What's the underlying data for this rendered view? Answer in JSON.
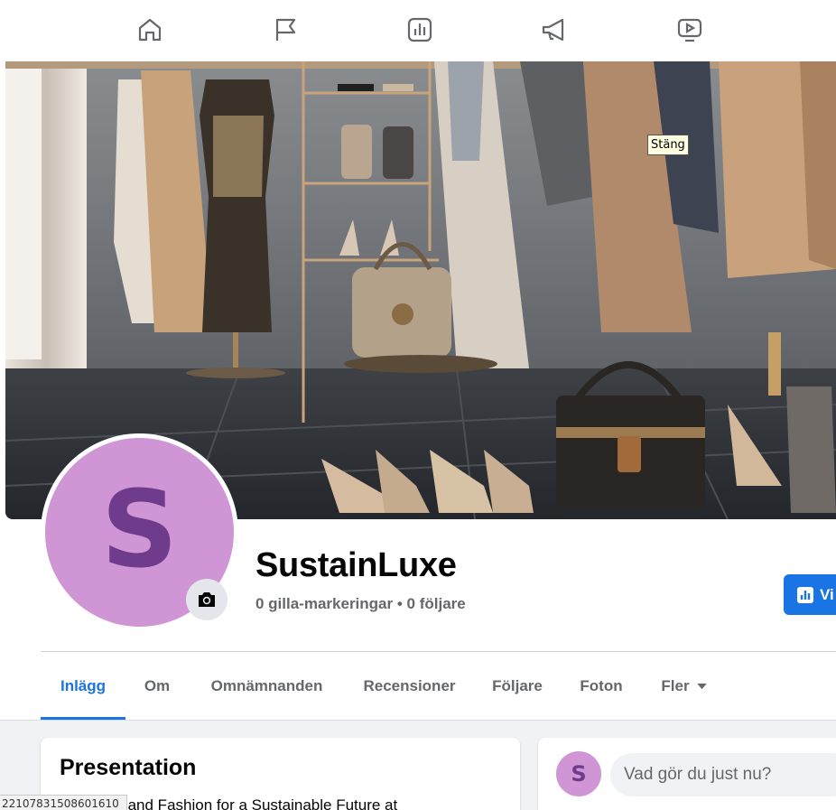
{
  "nav": {
    "icons": [
      "home-icon",
      "flag-icon",
      "insights-icon",
      "megaphone-icon",
      "video-icon"
    ]
  },
  "cover": {
    "tooltip": "Stäng"
  },
  "profile": {
    "avatar_letter": "S",
    "name": "SustainLuxe",
    "stats": "0 gilla-markeringar • 0 följare",
    "action_button_label": "Vi"
  },
  "tabs": [
    {
      "label": "Inlägg",
      "active": true
    },
    {
      "label": "Om",
      "active": false
    },
    {
      "label": "Omnämnanden",
      "active": false
    },
    {
      "label": "Recensioner",
      "active": false
    },
    {
      "label": "Följare",
      "active": false
    },
    {
      "label": "Foton",
      "active": false
    },
    {
      "label": "Fler",
      "active": false
    }
  ],
  "intro": {
    "title": "Presentation",
    "text": "Second-Hand Fashion for a Sustainable Future at"
  },
  "composer": {
    "avatar_letter": "S",
    "placeholder": "Vad gör du just nu?"
  },
  "status_bar": {
    "url": "22107831508601610"
  },
  "colors": {
    "accent": "#1b74e4",
    "avatar_bg": "#cf95d4",
    "avatar_letter": "#6f3b8c"
  }
}
